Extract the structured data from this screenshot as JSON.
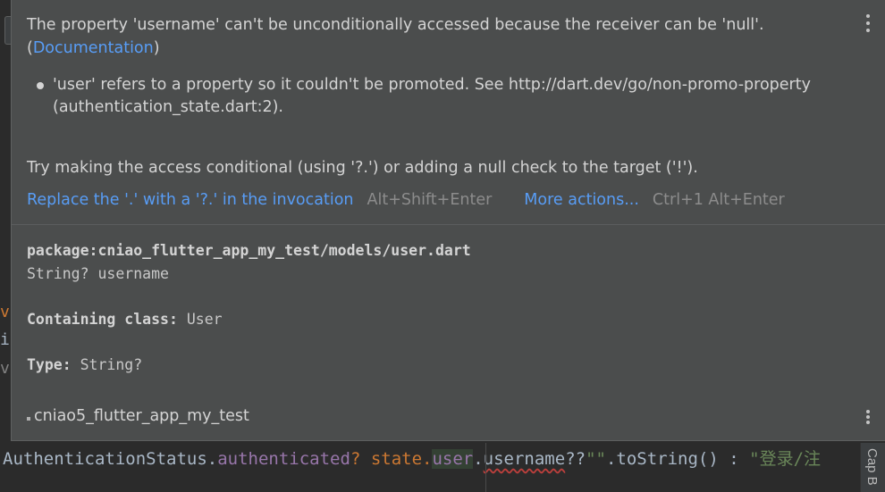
{
  "popup": {
    "message_line1": "The property 'username' can't be unconditionally accessed because the receiver can be 'null'.",
    "message_open_paren": "(",
    "message_link": "Documentation",
    "message_close_paren": ")",
    "bullet": "'user' refers to a property so it couldn't be promoted. See http://dart.dev/go/non-promo-property (authentication_state.dart:2).",
    "hint": "Try making the access conditional (using '?.') or adding a null check to the target ('!').",
    "actions": {
      "primary_label": "Replace the '.' with a '?.' in the invocation",
      "primary_shortcut": "Alt+Shift+Enter",
      "more_label": "More actions...",
      "more_shortcut": "Ctrl+1 Alt+Enter"
    },
    "doc": {
      "package": "package:cniao_flutter_app_my_test/models/user.dart",
      "signature": "String? username",
      "containing_label": "Containing class:",
      "containing_value": "User",
      "type_label": "Type:",
      "type_value": "String?"
    },
    "module": "cniao5_flutter_app_my_test"
  },
  "editor": {
    "code_parts": [
      "AuthenticationStatus.",
      "authenticated",
      "? state.",
      "user",
      ".",
      "username",
      "??",
      "\"\"",
      ".toString() : ",
      "\"登录/注"
    ],
    "side_frags": [
      "vo",
      "il",
      "vo"
    ],
    "gutter_label": "Cap B"
  }
}
